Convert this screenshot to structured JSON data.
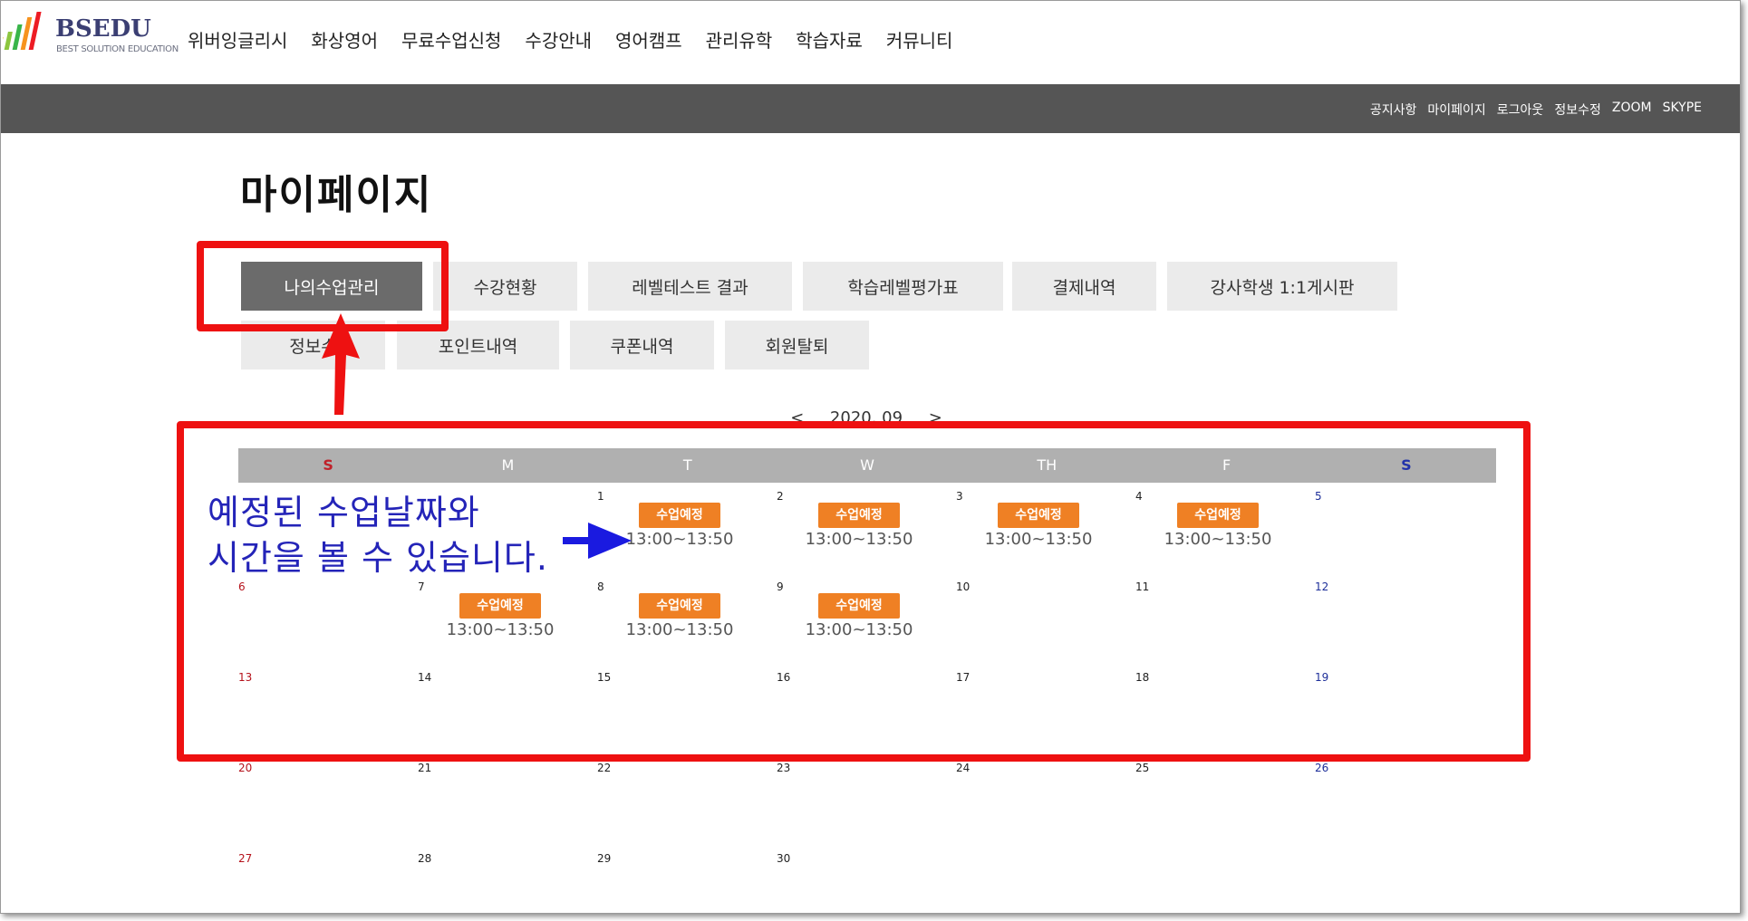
{
  "logo": {
    "name": "BSEDU",
    "tagline": "BEST SOLUTION EDUCATION"
  },
  "nav": [
    "위버잉글리시",
    "화상영어",
    "무료수업신청",
    "수강안내",
    "영어캠프",
    "관리유학",
    "학습자료",
    "커뮤니티"
  ],
  "util_links": [
    "공지사항",
    "마이페이지",
    "로그아웃",
    "정보수정",
    "ZOOM",
    "SKYPE"
  ],
  "page_title": "마이페이지",
  "tabs_row1": [
    "나의수업관리",
    "수강현황",
    "레벨테스트 결과",
    "학습레벨평가표",
    "결제내역",
    "강사학생 1:1게시판"
  ],
  "tabs_row2": [
    "정보수",
    "포인트내역",
    "쿠폰내역",
    "회원탈퇴"
  ],
  "active_tab": "나의수업관리",
  "calendar": {
    "month_label": "2020. 09",
    "weekdays": [
      "S",
      "M",
      "T",
      "W",
      "TH",
      "F",
      "S"
    ],
    "weeks": [
      [
        "",
        "",
        "1",
        "2",
        "3",
        "4",
        "5"
      ],
      [
        "6",
        "7",
        "8",
        "9",
        "10",
        "11",
        "12"
      ],
      [
        "13",
        "14",
        "15",
        "16",
        "17",
        "18",
        "19"
      ],
      [
        "20",
        "21",
        "22",
        "23",
        "24",
        "25",
        "26"
      ],
      [
        "27",
        "28",
        "29",
        "30",
        "",
        "",
        ""
      ]
    ],
    "scheduled_label": "수업예정",
    "scheduled_time": "13:00~13:50",
    "scheduled_days": [
      "1",
      "2",
      "3",
      "4",
      "7",
      "8",
      "9"
    ],
    "colors": {
      "badge": "#ef8024",
      "header": "#b0b0b0",
      "sunday": "#b5121b",
      "saturday": "#1e2f9a"
    }
  },
  "annotation": {
    "line1": "예정된 수업날짜와",
    "line2": "시간을 볼 수 있습니다.",
    "box_color": "#ee1111",
    "text_color": "#2424b8"
  }
}
